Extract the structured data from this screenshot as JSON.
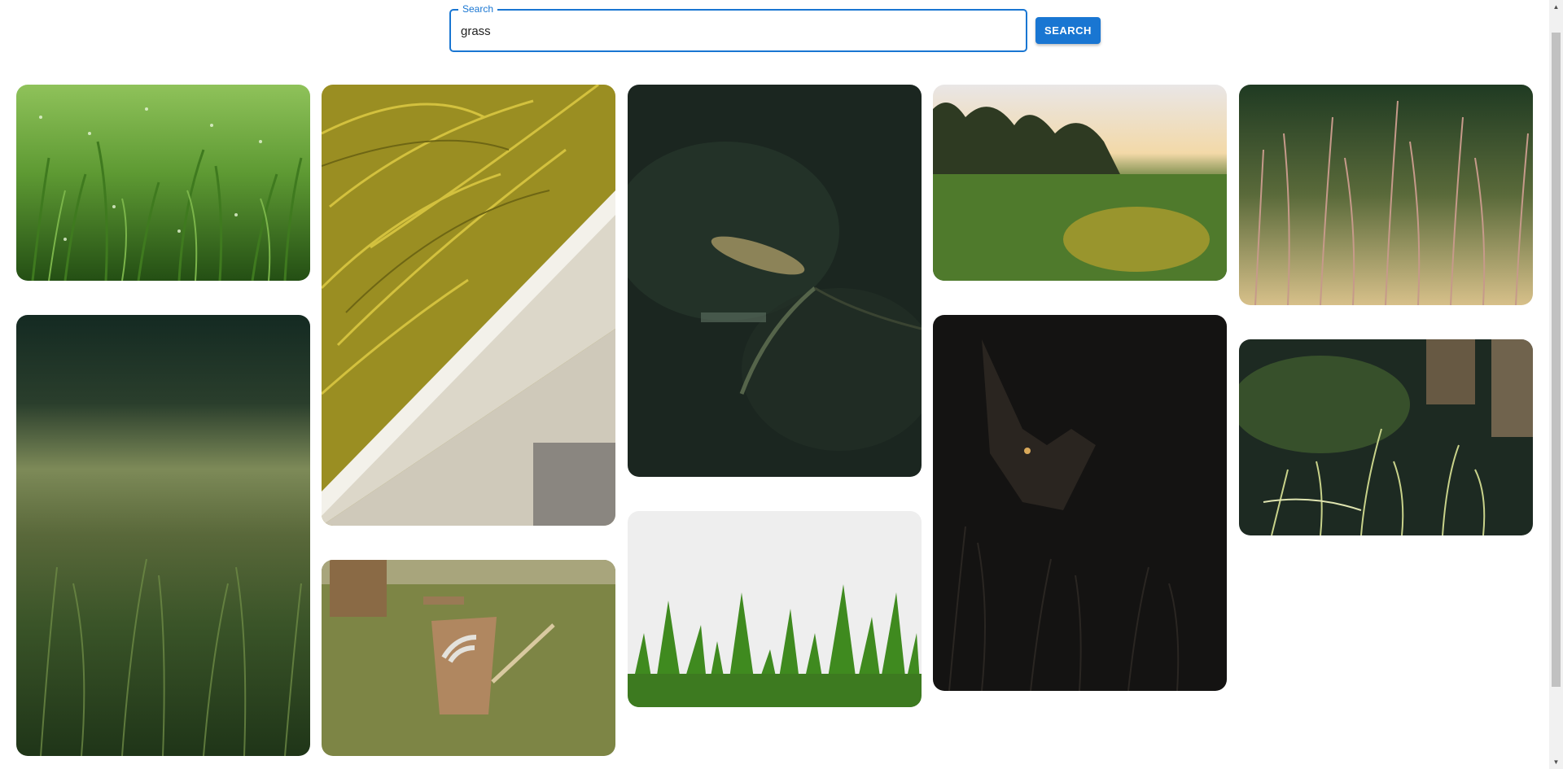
{
  "search": {
    "label": "Search",
    "value": "grass",
    "button_label": "SEARCH"
  },
  "gallery": {
    "photos": [
      {
        "subject": "dewy green grass close-up"
      },
      {
        "subject": "yellow ornamental grass beside concrete wall"
      },
      {
        "subject": "seed head grass stem on dark background"
      },
      {
        "subject": "grass field at sunset with trees"
      },
      {
        "subject": "tall pink grass stalks"
      },
      {
        "subject": "blurred grass on dark background"
      },
      {
        "subject": "wooden no wifi zone sign on lawn"
      },
      {
        "subject": "green grass blades on white background"
      },
      {
        "subject": "coyote in dark tall grass"
      },
      {
        "subject": "backlit grass stalks in forest"
      }
    ]
  },
  "colors": {
    "accent": "#1976d2"
  }
}
